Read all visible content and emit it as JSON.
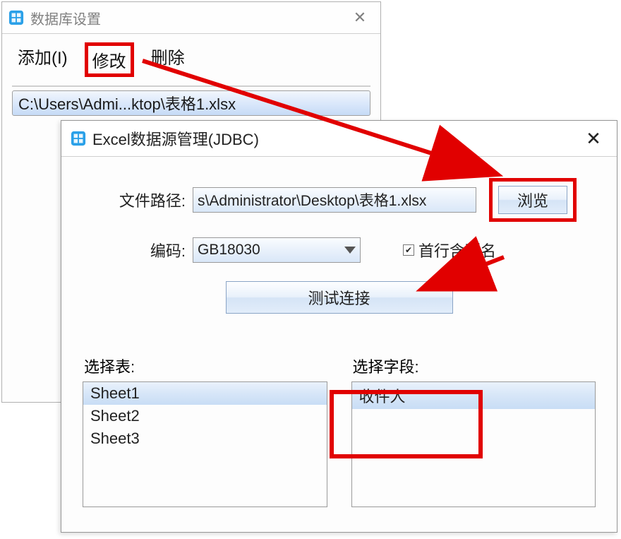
{
  "win1": {
    "title": "数据库设置",
    "menu": {
      "add": "添加(I)",
      "modify": "修改",
      "delete": "删除"
    },
    "path_display": "C:\\Users\\Admi...ktop\\表格1.xlsx"
  },
  "win2": {
    "title": "Excel数据源管理(JDBC)",
    "file_label": "文件路径:",
    "file_value": "s\\Administrator\\Desktop\\表格1.xlsx",
    "browse": "浏览",
    "encoding_label": "编码:",
    "encoding_value": "GB18030",
    "first_row_header_label": "首行含列名",
    "first_row_header_checked": true,
    "test_connection": "测试连接",
    "select_table_label": "选择表:",
    "select_field_label": "选择字段:",
    "tables": [
      "Sheet1",
      "Sheet2",
      "Sheet3"
    ],
    "fields": [
      "收件人"
    ],
    "selected_table": "Sheet1",
    "selected_field": "收件人"
  },
  "icons": {
    "close": "✕",
    "check": "✔"
  }
}
